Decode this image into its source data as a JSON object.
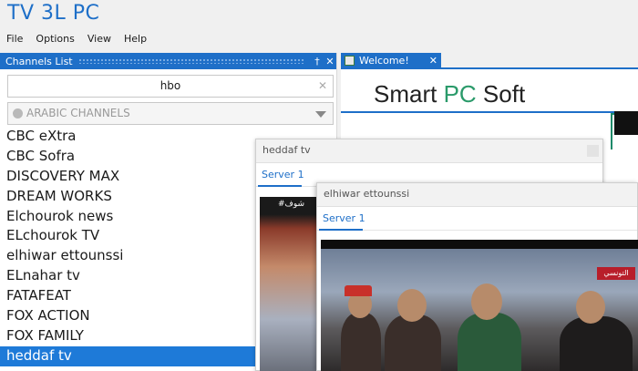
{
  "app": {
    "title": "TV 3L PC"
  },
  "menu": [
    {
      "label": "File"
    },
    {
      "label": "Options"
    },
    {
      "label": "View"
    },
    {
      "label": "Help"
    }
  ],
  "channels_panel": {
    "title": "Channels List",
    "pin_glyph": "†",
    "close_glyph": "✕",
    "search": {
      "value": "hbo",
      "clear_glyph": "✕"
    },
    "category": {
      "selected": "ARABIC CHANNELS"
    },
    "items": [
      {
        "label": "CBC eXtra"
      },
      {
        "label": "CBC Sofra"
      },
      {
        "label": "DISCOVERY MAX"
      },
      {
        "label": "DREAM WORKS"
      },
      {
        "label": "Elchourok news"
      },
      {
        "label": "ELchourok TV"
      },
      {
        "label": "elhiwar ettounssi"
      },
      {
        "label": "ELnahar tv"
      },
      {
        "label": "FATAFEAT"
      },
      {
        "label": "FOX ACTION"
      },
      {
        "label": "FOX FAMILY"
      },
      {
        "label": "heddaf tv"
      }
    ],
    "selected_item": "heddaf tv"
  },
  "welcome": {
    "tab_label": "Welcome!",
    "tab_close_glyph": "✕",
    "brand_left": "Smart ",
    "brand_accent": "PC",
    "brand_right": " Soft"
  },
  "player_windows": [
    {
      "title": "heddaf tv",
      "tab": "Server 1",
      "caption": "#شوف"
    },
    {
      "title": "elhiwar ettounssi",
      "tab": "Server 1",
      "badge": "التونسي"
    }
  ],
  "colors": {
    "accent": "#1e6fc8",
    "selection": "#1e7ad8",
    "brand_green": "#2a9a6a"
  }
}
